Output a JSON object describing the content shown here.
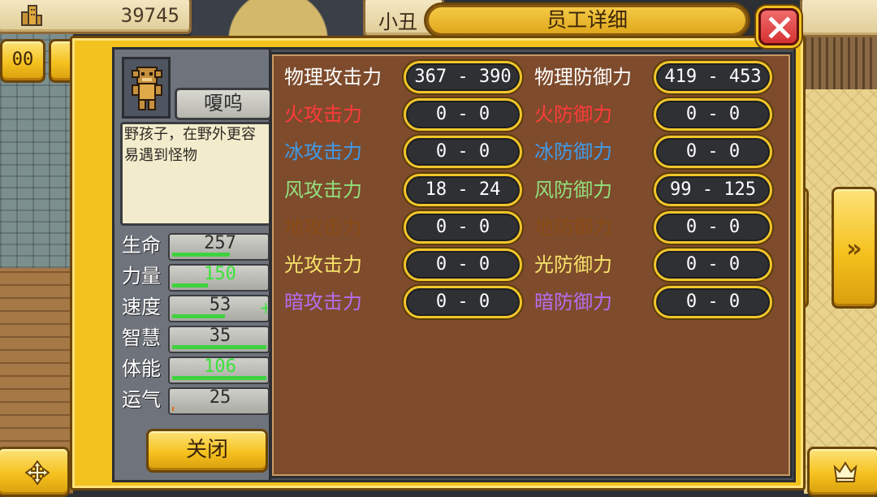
{
  "hud": {
    "money_icon": "building-icon",
    "money": "39745",
    "name_tab": "小丑"
  },
  "dialog": {
    "title": "员工详细",
    "close_icon": "close-x-icon",
    "employee": {
      "portrait": "monkey-character-sprite",
      "name": "嗄呜",
      "description": "野孩子，在野外更容易遇到怪物"
    },
    "stats": [
      {
        "label": "生命",
        "value": "257",
        "color": "#2e2e2e",
        "fill": 0.6,
        "bar": "#3fd23f"
      },
      {
        "label": "力量",
        "value": "150",
        "color": "#3be23b",
        "fill": 0.37,
        "bar": "#3fd23f"
      },
      {
        "label": "速度",
        "value": "53",
        "color": "#2e2e2e",
        "fill": 0.55,
        "bar": "#3fd23f",
        "plus": "+"
      },
      {
        "label": "智慧",
        "value": "35",
        "color": "#2e2e2e",
        "fill": 0.98,
        "bar": "#3fd23f"
      },
      {
        "label": "体能",
        "value": "106",
        "color": "#3be23b",
        "fill": 0.98,
        "bar": "#3fd23f"
      },
      {
        "label": "运气",
        "value": "25",
        "color": "#2e2e2e",
        "fill": 0.02,
        "bar": "#e26a13"
      }
    ],
    "close_button": "关闭",
    "attributes": [
      {
        "atk_label": "物理攻击力",
        "atk": "367 - 390",
        "def_label": "物理防御力",
        "def": "419 - 453",
        "color": "#ffffff"
      },
      {
        "atk_label": "火攻击力",
        "atk": "0 - 0",
        "def_label": "火防御力",
        "def": "0 - 0",
        "color": "#ff3b3b"
      },
      {
        "atk_label": "冰攻击力",
        "atk": "0 - 0",
        "def_label": "冰防御力",
        "def": "0 - 0",
        "color": "#3f9bea"
      },
      {
        "atk_label": "风攻击力",
        "atk": "18 - 24",
        "def_label": "风防御力",
        "def": "99 - 125",
        "color": "#93e07e"
      },
      {
        "atk_label": "地攻击力",
        "atk": "0 - 0",
        "def_label": "地防御力",
        "def": "0 - 0",
        "color": "#8a4a14"
      },
      {
        "atk_label": "光攻击力",
        "atk": "0 - 0",
        "def_label": "光防御力",
        "def": "0 - 0",
        "color": "#f7e36a"
      },
      {
        "atk_label": "暗攻击力",
        "atk": "0 - 0",
        "def_label": "暗防御力",
        "def": "0 - 0",
        "color": "#b46ef0"
      }
    ]
  },
  "side_buttons": {
    "top_left": "00",
    "prev": "«",
    "next": "»",
    "bottom_left_icon": "dpad-icon",
    "bottom_right_icon": "crown-icon"
  }
}
